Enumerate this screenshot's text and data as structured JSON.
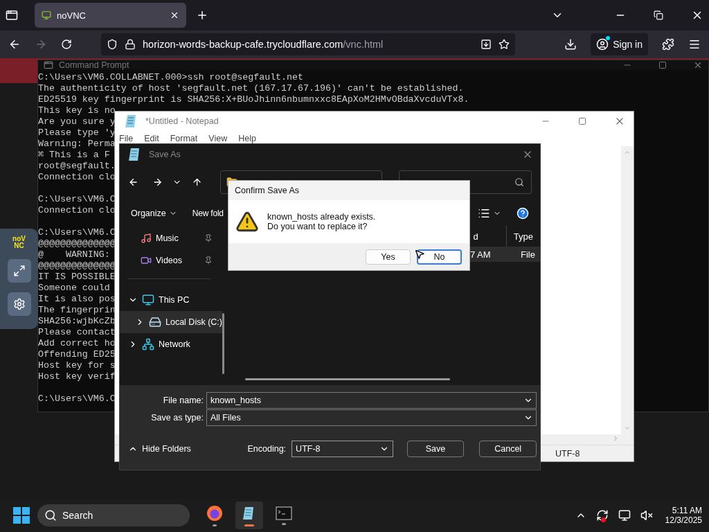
{
  "browser": {
    "tab": {
      "title": "noVNC",
      "selected": true
    },
    "back_disabled": false,
    "forward_disabled": true,
    "url_host": "horizon-words-backup-cafe.trycloudflare.com",
    "url_path": "/vnc.html",
    "sign_in": "Sign in"
  },
  "novnc_panel": {
    "logo": "noVNC"
  },
  "command_prompt": {
    "title": "Command Prompt",
    "blocks": [
      [
        "C:\\Users\\VM6.COLLABNET.000>ssh root@segfault.net",
        "The authenticity of host 'segfault.net (167.17.67.196)' can't be established.",
        "ED25519 key fingerprint is SHA256:X+BUoJhinn6nbumnxxc8EApXoM2HMvOBdaXvcduVTx8.",
        "This key is no",
        "Are you sure y",
        "Please type 'y",
        "Warning: Perma",
        "⌘ This is a F",
        "root@segfault.",
        "Connection clo"
      ],
      [
        "C:\\Users\\VM6.C",
        "Connection clo"
      ],
      [
        "C:\\Users\\VM6.C",
        "@@@@@@@@@@@@@@",
        "@    WARNING: ",
        "@@@@@@@@@@@@@@",
        "IT IS POSSIBLE",
        "Someone could ",
        "It is also pos",
        "The fingerprin",
        "SHA256:wjbKcZb",
        "Please contact",
        "Add correct ho",
        "Offending ED25",
        "Host key for s",
        "Host key verif"
      ],
      [
        "C:\\Users\\VM6.C"
      ]
    ]
  },
  "notepad": {
    "title": "*Untitled - Notepad",
    "menu": [
      "File",
      "Edit",
      "Format",
      "View",
      "Help"
    ],
    "status_encoding": "UTF-8"
  },
  "save_as": {
    "title": "Save As",
    "organize": "Organize",
    "new_folder": "New fold",
    "quick_access": [
      {
        "label": "Music",
        "kind": "music",
        "pinned": true
      },
      {
        "label": "Videos",
        "kind": "videos",
        "pinned": true
      }
    ],
    "tree": [
      {
        "label": "This PC",
        "kind": "pc",
        "expanded": true,
        "selected": false,
        "children": [
          {
            "label": "Local Disk (C:)",
            "kind": "disk",
            "expanded": false,
            "selected": true
          }
        ]
      },
      {
        "label": "Network",
        "kind": "network",
        "expanded": false,
        "selected": false
      }
    ],
    "columns": [
      "d",
      "Type"
    ],
    "rows": [
      {
        "cells": [
          "7 AM",
          "File"
        ],
        "selected": true
      }
    ],
    "file_name": {
      "label": "File name:",
      "value": "known_hosts"
    },
    "save_as_type": {
      "label": "Save as type:",
      "value": "All Files"
    },
    "hide_folders": "Hide Folders",
    "encoding": {
      "label": "Encoding:",
      "value": "UTF-8"
    },
    "buttons": [
      "Save",
      "Cancel"
    ]
  },
  "confirm": {
    "title": "Confirm Save As",
    "message": [
      "known_hosts already exists.",
      "Do you want to replace it?"
    ],
    "buttons": [
      {
        "label": "Yes",
        "focused": false
      },
      {
        "label": "No",
        "focused": true
      }
    ]
  },
  "taskbar": {
    "search": "Search",
    "apps": [
      {
        "kind": "firefox",
        "active": false
      },
      {
        "kind": "notepad",
        "active": true
      },
      {
        "kind": "terminal",
        "active": false
      }
    ],
    "time": "5:11 AM",
    "date": "12/3/2025"
  }
}
